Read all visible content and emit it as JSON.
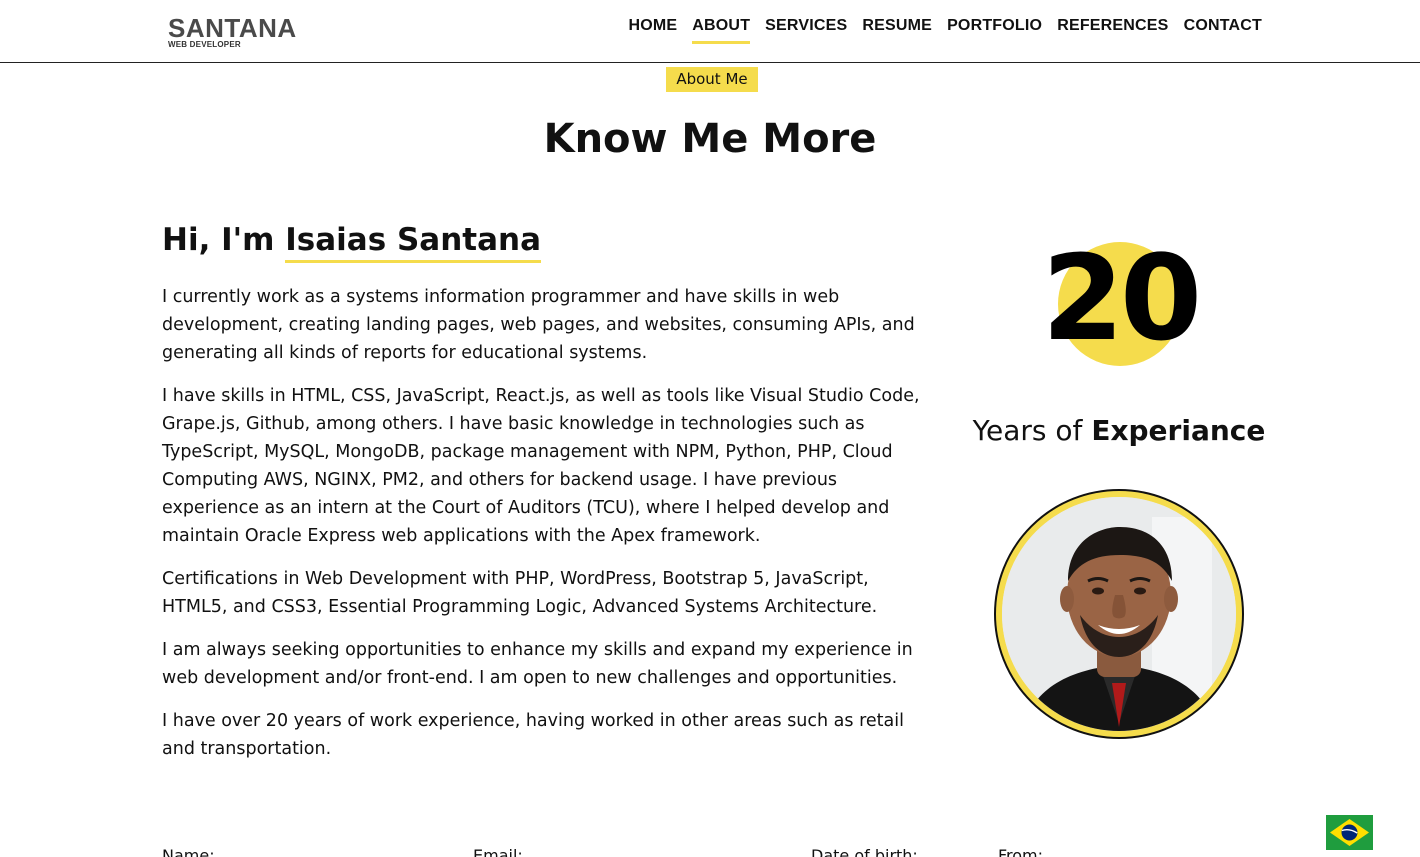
{
  "header": {
    "logo_main": "SANTANA",
    "logo_sub": "WEB DEVELOPER",
    "nav": [
      {
        "label": "HOME"
      },
      {
        "label": "ABOUT",
        "active": true
      },
      {
        "label": "SERVICES"
      },
      {
        "label": "RESUME"
      },
      {
        "label": "PORTFOLIO"
      },
      {
        "label": "REFERENCES"
      },
      {
        "label": "CONTACT"
      }
    ]
  },
  "section": {
    "tag": "About Me",
    "title": "Know Me More"
  },
  "intro": {
    "greeting": "Hi, I'm ",
    "name": "Isaias Santana"
  },
  "bio": [
    "I currently work as a systems information programmer and have skills in web development, creating landing pages, web pages, and websites, consuming APIs, and generating all kinds of reports for educational systems.",
    "I have skills in HTML, CSS, JavaScript, React.js, as well as tools like Visual Studio Code, Grape.js, Github, among others. I have basic knowledge in technologies such as TypeScript, MySQL, MongoDB, package management with NPM, Python, PHP, Cloud Computing AWS, NGINX, PM2, and others for backend usage. I have previous experience as an intern at the Court of Auditors (TCU), where I helped develop and maintain Oracle Express web applications with the Apex framework.",
    "Certifications in Web Development with PHP, WordPress, Bootstrap 5, JavaScript, HTML5, and CSS3, Essential Programming Logic, Advanced Systems Architecture.",
    "I am always seeking opportunities to enhance my skills and expand my experience in web development and/or front-end. I am open to new challenges and opportunities.",
    "I have over 20 years of work experience, having worked in other areas such as retail and transportation."
  ],
  "experience": {
    "years": "20",
    "label_prefix": "Years of ",
    "label_bold": "Experiance"
  },
  "info_labels": [
    "Name:",
    "Email:",
    "Date of birth:",
    "From:"
  ],
  "colors": {
    "accent": "#f5dc4c",
    "text": "#111111",
    "flag_green": "#1f9d3e",
    "flag_yellow": "#fedf00",
    "flag_blue": "#002776"
  },
  "icons": {
    "language_switch": "brazil-flag-icon"
  }
}
